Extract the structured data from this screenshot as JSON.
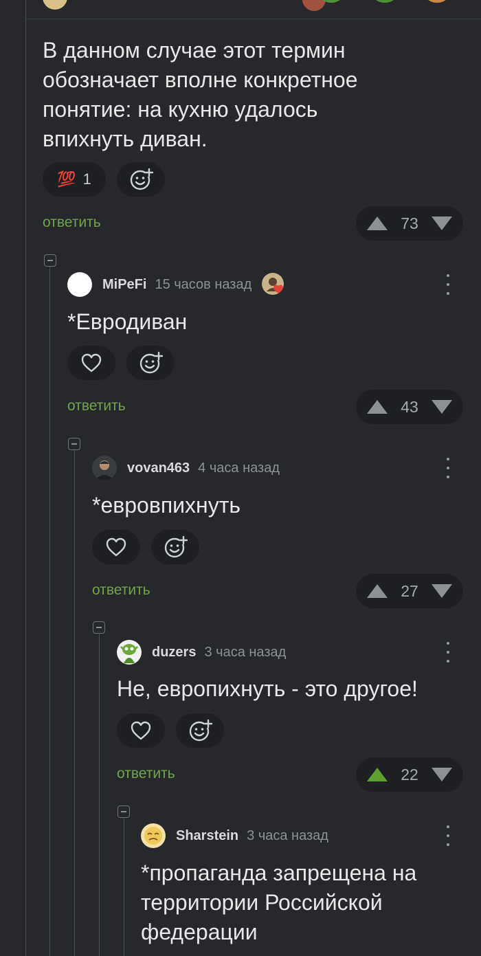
{
  "comments": [
    {
      "text_lines": [
        "В данном случае этот термин",
        "обозначает вполне конкретное",
        "понятие: на кухню удалось",
        "впихнуть диван."
      ],
      "reaction": {
        "emoji": "💯",
        "count": "1"
      },
      "reply_label": "ответить",
      "score": "73"
    },
    {
      "username": "MiPeFi",
      "time": "15 часов назад",
      "text_lines": [
        "*Евродиван"
      ],
      "reply_label": "ответить",
      "score": "43"
    },
    {
      "username": "vovan463",
      "time": "4 часа назад",
      "text_lines": [
        "*евровпихнуть"
      ],
      "reply_label": "ответить",
      "score": "27"
    },
    {
      "username": "duzers",
      "time": "3 часа назад",
      "text_lines": [
        "Не, европихнуть - это другое!"
      ],
      "reply_label": "ответить",
      "score": "22",
      "upvoted": true
    },
    {
      "username": "Sharstein",
      "time": "3 часа назад",
      "text_lines": [
        "*пропаганда запрещена на",
        "территории Российской",
        "федерации"
      ]
    }
  ],
  "icons": {
    "heart": "heart-icon",
    "add_reaction": "smiley-plus-icon",
    "upvote": "arrow-up-icon",
    "downvote": "arrow-down-icon",
    "collapse": "collapse-minus-icon",
    "more": "more-vertical-icon"
  },
  "colors": {
    "background": "#26282c",
    "accent_green": "#70a54a",
    "upvote_active": "#5da130",
    "pill_bg": "#1d1f22"
  }
}
